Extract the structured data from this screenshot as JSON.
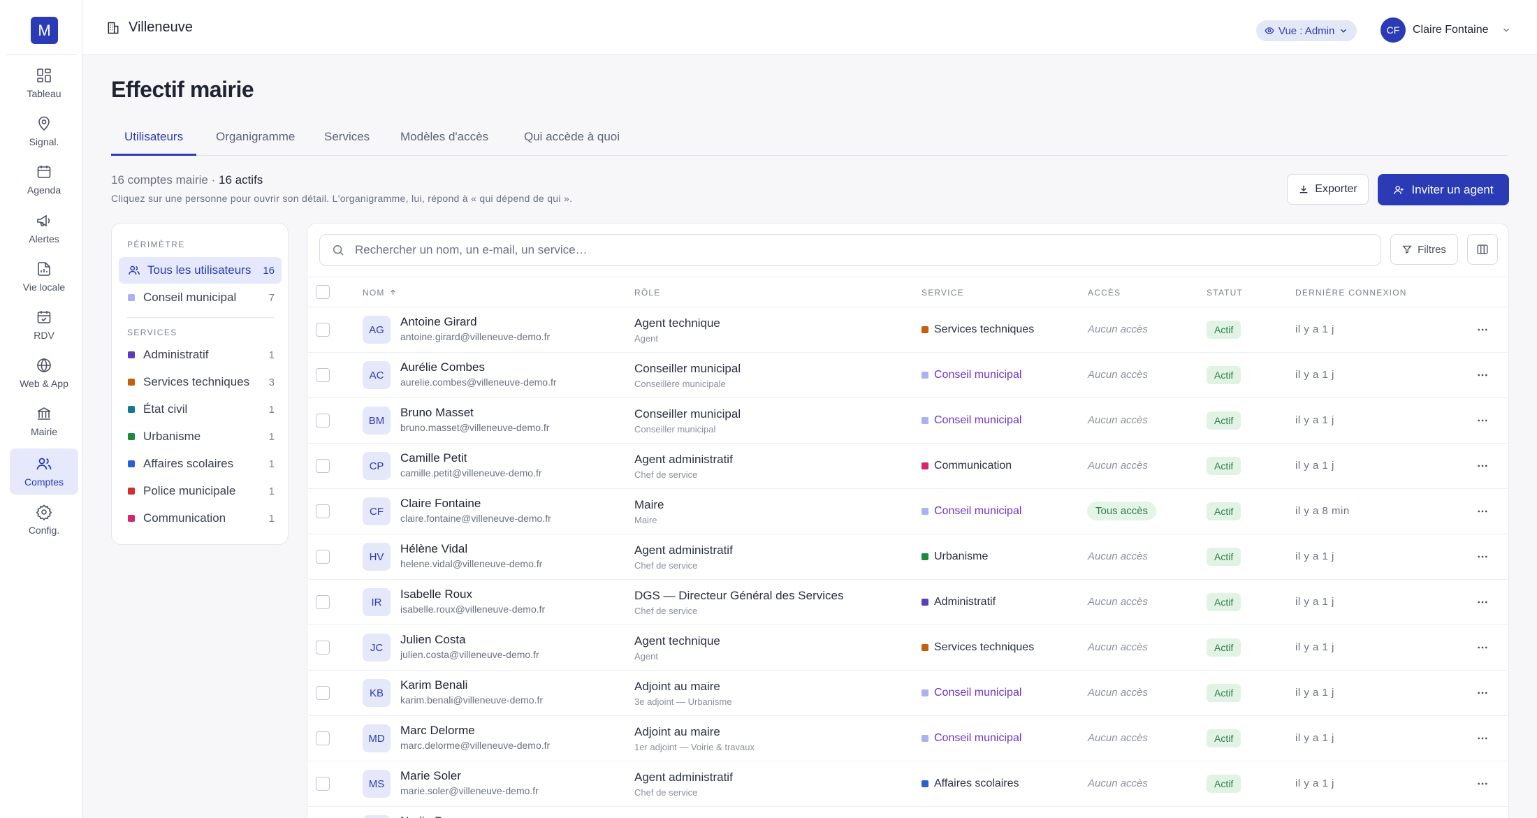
{
  "app": {
    "logo_letter": "M",
    "organization": "Villeneuve"
  },
  "rail": [
    {
      "label": "Tableau",
      "icon": "dashboard-icon"
    },
    {
      "label": "Signal.",
      "icon": "map-pin-icon"
    },
    {
      "label": "Agenda",
      "icon": "calendar-icon"
    },
    {
      "label": "Alertes",
      "icon": "megaphone-icon"
    },
    {
      "label": "Vie locale",
      "icon": "file-chart-icon"
    },
    {
      "label": "RDV",
      "icon": "calendar-check-icon"
    },
    {
      "label": "Web & App",
      "icon": "globe-icon"
    },
    {
      "label": "Mairie",
      "icon": "town-hall-icon"
    },
    {
      "label": "Comptes",
      "icon": "users-icon",
      "active": true
    },
    {
      "label": "Config.",
      "icon": "gear-icon"
    }
  ],
  "topbar": {
    "view_label": "Vue : Admin",
    "user_initials": "CF",
    "user_name": "Claire Fontaine"
  },
  "page": {
    "title": "Effectif mairie",
    "tabs": [
      "Utilisateurs",
      "Organigramme",
      "Services",
      "Modèles d'accès",
      "Qui accède à quoi"
    ],
    "active_tab": "Utilisateurs",
    "summary_prefix": "16 comptes mairie · ",
    "summary_active": "16 actifs",
    "hint": "Cliquez sur une personne pour ouvrir son détail. L'organigramme, lui, répond à « qui dépend de qui ».",
    "export_label": "Exporter",
    "invite_label": "Inviter un agent"
  },
  "scope": {
    "heading": "PÉRIMÈTRE",
    "all_label": "Tous les utilisateurs",
    "all_count": "16",
    "council_label": "Conseil municipal",
    "council_count": "7",
    "council_color": "#a9b3f2",
    "services_heading": "SERVICES",
    "services": [
      {
        "name": "Administratif",
        "count": "1",
        "color": "#5b3fb8"
      },
      {
        "name": "Services techniques",
        "count": "3",
        "color": "#c2600f"
      },
      {
        "name": "État civil",
        "count": "1",
        "color": "#157a8c"
      },
      {
        "name": "Urbanisme",
        "count": "1",
        "color": "#1c8a3b"
      },
      {
        "name": "Affaires scolaires",
        "count": "1",
        "color": "#2a5fd6"
      },
      {
        "name": "Police municipale",
        "count": "1",
        "color": "#d12f2f"
      },
      {
        "name": "Communication",
        "count": "1",
        "color": "#d6246e"
      }
    ]
  },
  "table": {
    "search_placeholder": "Rechercher un nom, un e-mail, un service…",
    "filters_label": "Filtres",
    "headers": {
      "name": "NOM",
      "role": "RÔLE",
      "service": "SERVICE",
      "access": "ACCÈS",
      "status": "STATUT",
      "last": "DERNIÈRE CONNEXION"
    },
    "rows": [
      {
        "initials": "AG",
        "name": "Antoine Girard",
        "email": "antoine.girard@villeneuve-demo.fr",
        "role": "Agent technique",
        "sub": "Agent",
        "service": "Services techniques",
        "service_color": "#c2600f",
        "council": false,
        "access": "Aucun accès",
        "full_access": false,
        "status": "Actif",
        "last": "il y a 1 j"
      },
      {
        "initials": "AC",
        "name": "Aurélie Combes",
        "email": "aurelie.combes@villeneuve-demo.fr",
        "role": "Conseiller municipal",
        "sub": "Conseillère municipale",
        "service": "Conseil municipal",
        "service_color": "#a9b3f2",
        "council": true,
        "access": "Aucun accès",
        "full_access": false,
        "status": "Actif",
        "last": "il y a 1 j"
      },
      {
        "initials": "BM",
        "name": "Bruno Masset",
        "email": "bruno.masset@villeneuve-demo.fr",
        "role": "Conseiller municipal",
        "sub": "Conseiller municipal",
        "service": "Conseil municipal",
        "service_color": "#a9b3f2",
        "council": true,
        "access": "Aucun accès",
        "full_access": false,
        "status": "Actif",
        "last": "il y a 1 j"
      },
      {
        "initials": "CP",
        "name": "Camille Petit",
        "email": "camille.petit@villeneuve-demo.fr",
        "role": "Agent administratif",
        "sub": "Chef de service",
        "service": "Communication",
        "service_color": "#d6246e",
        "council": false,
        "access": "Aucun accès",
        "full_access": false,
        "status": "Actif",
        "last": "il y a 1 j"
      },
      {
        "initials": "CF",
        "name": "Claire Fontaine",
        "email": "claire.fontaine@villeneuve-demo.fr",
        "role": "Maire",
        "sub": "Maire",
        "service": "Conseil municipal",
        "service_color": "#a9b3f2",
        "council": true,
        "access": "Tous accès",
        "full_access": true,
        "status": "Actif",
        "last": "il y a 8 min"
      },
      {
        "initials": "HV",
        "name": "Hélène Vidal",
        "email": "helene.vidal@villeneuve-demo.fr",
        "role": "Agent administratif",
        "sub": "Chef de service",
        "service": "Urbanisme",
        "service_color": "#1c8a3b",
        "council": false,
        "access": "Aucun accès",
        "full_access": false,
        "status": "Actif",
        "last": "il y a 1 j"
      },
      {
        "initials": "IR",
        "name": "Isabelle Roux",
        "email": "isabelle.roux@villeneuve-demo.fr",
        "role": "DGS — Directeur Général des Services",
        "sub": "Chef de service",
        "service": "Administratif",
        "service_color": "#5b3fb8",
        "council": false,
        "access": "Aucun accès",
        "full_access": false,
        "status": "Actif",
        "last": "il y a 1 j"
      },
      {
        "initials": "JC",
        "name": "Julien Costa",
        "email": "julien.costa@villeneuve-demo.fr",
        "role": "Agent technique",
        "sub": "Agent",
        "service": "Services techniques",
        "service_color": "#c2600f",
        "council": false,
        "access": "Aucun accès",
        "full_access": false,
        "status": "Actif",
        "last": "il y a 1 j"
      },
      {
        "initials": "KB",
        "name": "Karim Benali",
        "email": "karim.benali@villeneuve-demo.fr",
        "role": "Adjoint au maire",
        "sub": "3e adjoint — Urbanisme",
        "service": "Conseil municipal",
        "service_color": "#a9b3f2",
        "council": true,
        "access": "Aucun accès",
        "full_access": false,
        "status": "Actif",
        "last": "il y a 1 j"
      },
      {
        "initials": "MD",
        "name": "Marc Delorme",
        "email": "marc.delorme@villeneuve-demo.fr",
        "role": "Adjoint au maire",
        "sub": "1er adjoint — Voirie & travaux",
        "service": "Conseil municipal",
        "service_color": "#a9b3f2",
        "council": true,
        "access": "Aucun accès",
        "full_access": false,
        "status": "Actif",
        "last": "il y a 1 j"
      },
      {
        "initials": "MS",
        "name": "Marie Soler",
        "email": "marie.soler@villeneuve-demo.fr",
        "role": "Agent administratif",
        "sub": "Chef de service",
        "service": "Affaires scolaires",
        "service_color": "#2a5fd6",
        "council": false,
        "access": "Aucun accès",
        "full_access": false,
        "status": "Actif",
        "last": "il y a 1 j"
      },
      {
        "initials": "NB",
        "name": "Nadia Berna",
        "email": "",
        "role": "Agent administratif",
        "sub": "",
        "service": "",
        "service_color": "#a9b3f2",
        "council": false,
        "access": "",
        "full_access": false,
        "status": "",
        "last": ""
      }
    ]
  }
}
